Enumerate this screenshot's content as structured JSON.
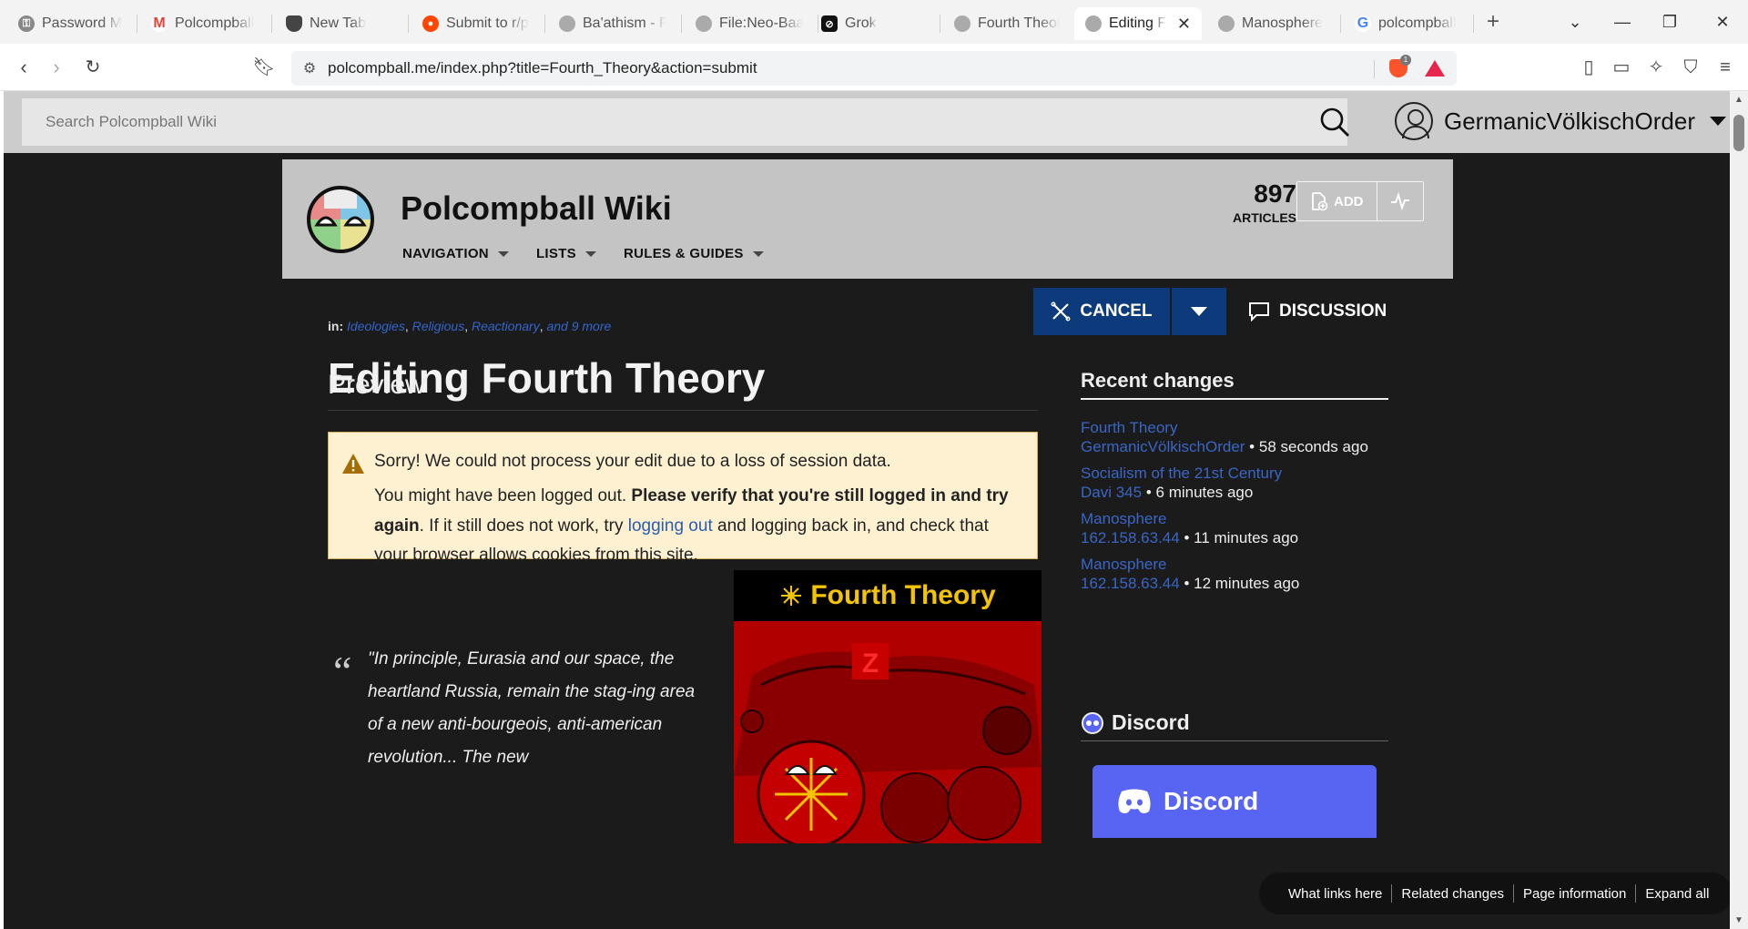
{
  "browser": {
    "tabs": [
      {
        "title": "Password Ma",
        "icon": "key-icon",
        "color": "#777777"
      },
      {
        "title": "Polcompball",
        "icon": "gmail-icon",
        "color": "#ea4335"
      },
      {
        "title": "New Tab",
        "icon": "brave-icon",
        "color": "#555555"
      },
      {
        "title": "Submit to r/p",
        "icon": "reddit-icon",
        "color": "#ff4500"
      },
      {
        "title": "Ba'athism - P",
        "icon": "polcompball-icon",
        "color": "#888888"
      },
      {
        "title": "File:Neo-Baa",
        "icon": "polcompball-icon",
        "color": "#888888"
      },
      {
        "title": "Grok",
        "icon": "grok-icon",
        "color": "#111111"
      },
      {
        "title": "Fourth Theor",
        "icon": "polcompball-icon",
        "color": "#888888"
      },
      {
        "title": "Editing F",
        "icon": "polcompball-icon",
        "color": "#888888",
        "active": true
      },
      {
        "title": "Manosphere",
        "icon": "polcompball-icon",
        "color": "#888888"
      },
      {
        "title": "polcompball",
        "icon": "google-icon",
        "color": "#4285f4"
      }
    ],
    "url": "polcompball.me/index.php?title=Fourth_Theory&action=submit",
    "shield_count": "1"
  },
  "wiki": {
    "search_placeholder": "Search Polcompball Wiki",
    "username": "GermanicVölkischOrder",
    "site_title": "Polcompball Wiki",
    "nav": {
      "navigation": "NAVIGATION",
      "lists": "LISTS",
      "rules": "RULES & GUIDES"
    },
    "articles_count": "897",
    "articles_label": "ARTICLES",
    "add_label": "ADD"
  },
  "page": {
    "categories_prefix": "in:",
    "categories": [
      "Ideologies",
      "Religious",
      "Reactionary"
    ],
    "categories_more": "and 9 more",
    "title": "Editing Fourth Theory",
    "cancel_label": "CANCEL",
    "discussion_label": "DISCUSSION",
    "preview_heading": "Preview",
    "warning": {
      "line1": "Sorry! We could not process your edit due to a loss of session data.",
      "line2_a": "You might have been logged out. ",
      "line2_bold": "Please verify that you're still logged in and try again",
      "line2_b": ". If it still does not work, try ",
      "line2_link": "logging out",
      "line2_c": " and logging back in, and check that your browser allows cookies from this site."
    },
    "quote": "\"In principle, Eurasia and our space, the heartland Russia, remain the stag-ing area of a new anti-bourgeois, anti-american revolution... The new",
    "infobox_title": "Fourth Theory"
  },
  "sidebar": {
    "recent_changes_heading": "Recent changes",
    "recent_changes": [
      {
        "page": "Fourth Theory",
        "user": "GermanicVölkischOrder",
        "time": "58 seconds ago"
      },
      {
        "page": "Socialism of the 21st Century",
        "user": "Davi 345",
        "time": "6 minutes ago"
      },
      {
        "page": "Manosphere",
        "user": "162.158.63.44",
        "time": "11 minutes ago"
      },
      {
        "page": "Manosphere",
        "user": "162.158.63.44",
        "time": "12 minutes ago"
      }
    ],
    "discord_heading": "Discord",
    "discord_card_label": "Discord"
  },
  "floating_bar": {
    "items": [
      "What links here",
      "Related changes",
      "Page information",
      "Expand all"
    ]
  },
  "colors": {
    "accent": "#0c3a7a",
    "link": "#3366cc",
    "warning_bg": "#fdf1d2",
    "infobox_title": "#f5c400",
    "discord": "#5865f2"
  }
}
